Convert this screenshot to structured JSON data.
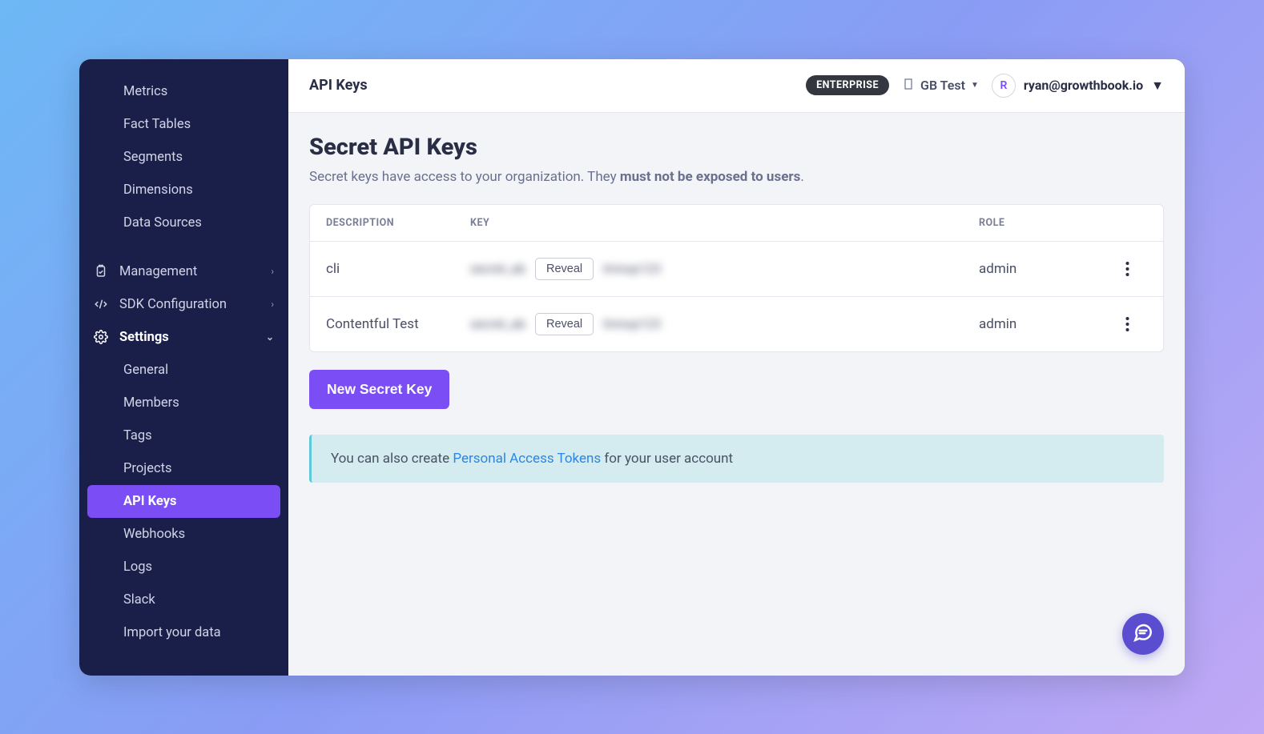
{
  "topbar": {
    "title": "API Keys",
    "badge": "ENTERPRISE",
    "org": "GB Test",
    "user_email": "ryan@growthbook.io",
    "avatar_letter": "R"
  },
  "sidebar": {
    "simple_items": [
      "Metrics",
      "Fact Tables",
      "Segments",
      "Dimensions",
      "Data Sources"
    ],
    "management_label": "Management",
    "sdk_label": "SDK Configuration",
    "settings_label": "Settings",
    "settings_items": [
      "General",
      "Members",
      "Tags",
      "Projects",
      "API Keys",
      "Webhooks",
      "Logs",
      "Slack",
      "Import your data"
    ]
  },
  "page": {
    "heading": "Secret API Keys",
    "subtitle_pre": "Secret keys have access to your organization. They ",
    "subtitle_bold": "must not be exposed to users",
    "subtitle_post": "."
  },
  "table": {
    "headers": {
      "desc": "DESCRIPTION",
      "key": "KEY",
      "role": "ROLE"
    },
    "rows": [
      {
        "description": "cli",
        "key_blur_pre": "secret_ab",
        "key_blur_post": "lmnop123",
        "reveal": "Reveal",
        "role": "admin"
      },
      {
        "description": "Contentful Test",
        "key_blur_pre": "secret_ab",
        "key_blur_post": "lmnop123",
        "reveal": "Reveal",
        "role": "admin"
      }
    ]
  },
  "new_key_button": "New Secret Key",
  "info": {
    "pre": "You can also create ",
    "link": "Personal Access Tokens",
    "post": " for your user account"
  }
}
